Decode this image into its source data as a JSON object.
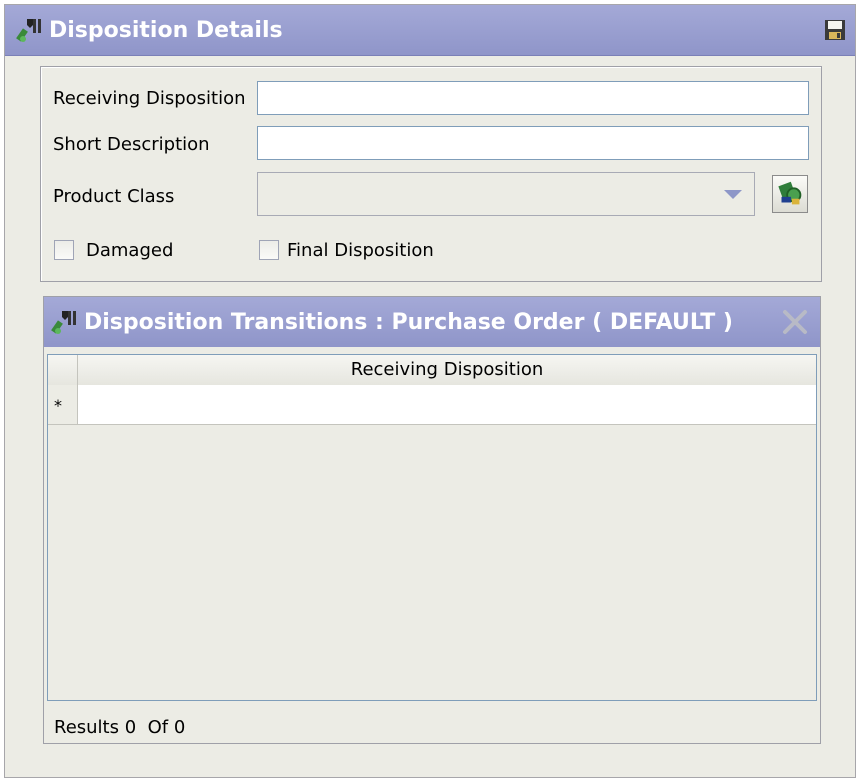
{
  "window": {
    "title": "Disposition Details",
    "title_icon": "wrench-icon",
    "save_icon": "floppy-disk-icon"
  },
  "form": {
    "receiving_disposition": {
      "label": "Receiving Disposition",
      "value": ""
    },
    "short_description": {
      "label": "Short Description",
      "value": ""
    },
    "product_class": {
      "label": "Product Class",
      "value": ""
    },
    "lookup_icon": "product-lookup-icon",
    "damaged": {
      "label": "Damaged",
      "checked": false
    },
    "final_disposition": {
      "label": "Final Disposition",
      "checked": false
    }
  },
  "transitions": {
    "title": "Disposition Transitions : Purchase Order ( DEFAULT )",
    "delete_icon": "delete-x-icon",
    "columns": [
      "Receiving Disposition"
    ],
    "new_row_marker": "*",
    "rows": [],
    "results_text": "Results 0  Of 0"
  },
  "colors": {
    "titlebar": "#969bcf",
    "panel_bg": "#ecece5",
    "field_border": "#7f9db9"
  }
}
